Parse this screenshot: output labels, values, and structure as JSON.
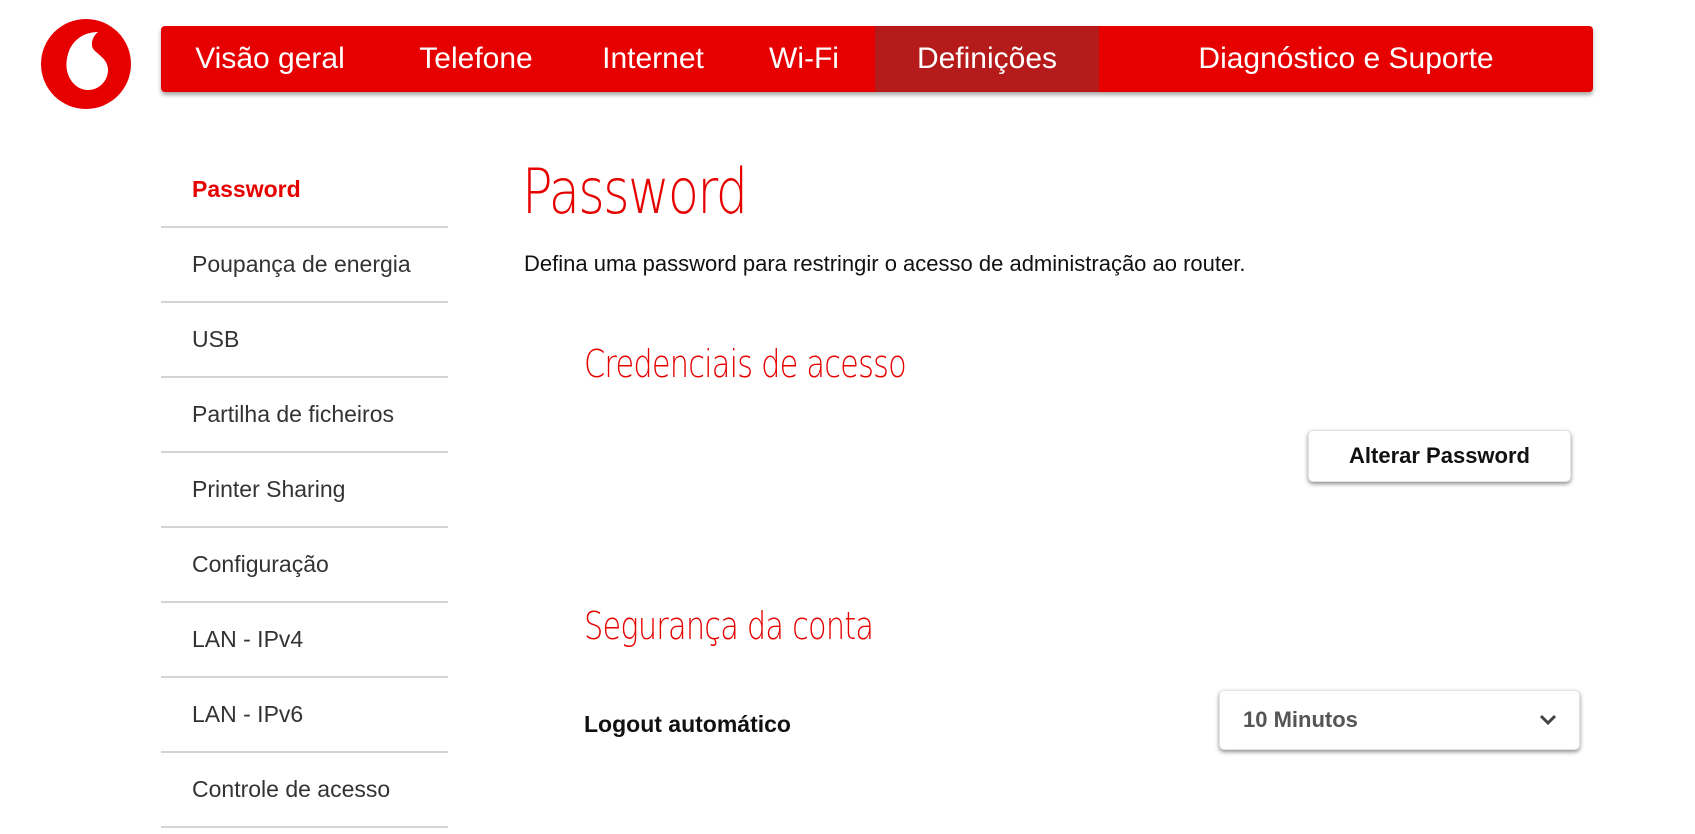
{
  "brand": {
    "logo_icon": "vodafone-logo-icon",
    "accent_color": "#e60000",
    "active_tab_color": "#b51b1b"
  },
  "nav": {
    "items": [
      {
        "label": "Visão geral",
        "active": false
      },
      {
        "label": "Telefone",
        "active": false
      },
      {
        "label": "Internet",
        "active": false
      },
      {
        "label": "Wi-Fi",
        "active": false
      },
      {
        "label": "Definições",
        "active": true
      },
      {
        "label": "Diagnóstico e Suporte",
        "active": false
      }
    ]
  },
  "sidebar": {
    "items": [
      {
        "label": "Password",
        "active": true
      },
      {
        "label": "Poupança de energia",
        "active": false
      },
      {
        "label": "USB",
        "active": false
      },
      {
        "label": "Partilha de ficheiros",
        "active": false
      },
      {
        "label": "Printer Sharing",
        "active": false
      },
      {
        "label": "Configuração",
        "active": false
      },
      {
        "label": "LAN - IPv4",
        "active": false
      },
      {
        "label": "LAN - IPv6",
        "active": false
      },
      {
        "label": "Controle de acesso",
        "active": false
      }
    ]
  },
  "main": {
    "title": "Password",
    "description": "Defina uma password para restringir o acesso de administração ao router.",
    "credentials": {
      "title": "Credenciais de acesso",
      "change_password_button": "Alterar Password"
    },
    "security": {
      "title": "Segurança da conta",
      "auto_logout_label": "Logout automático",
      "auto_logout_value": "10 Minutos",
      "dropdown_icon": "chevron-down-icon"
    }
  }
}
